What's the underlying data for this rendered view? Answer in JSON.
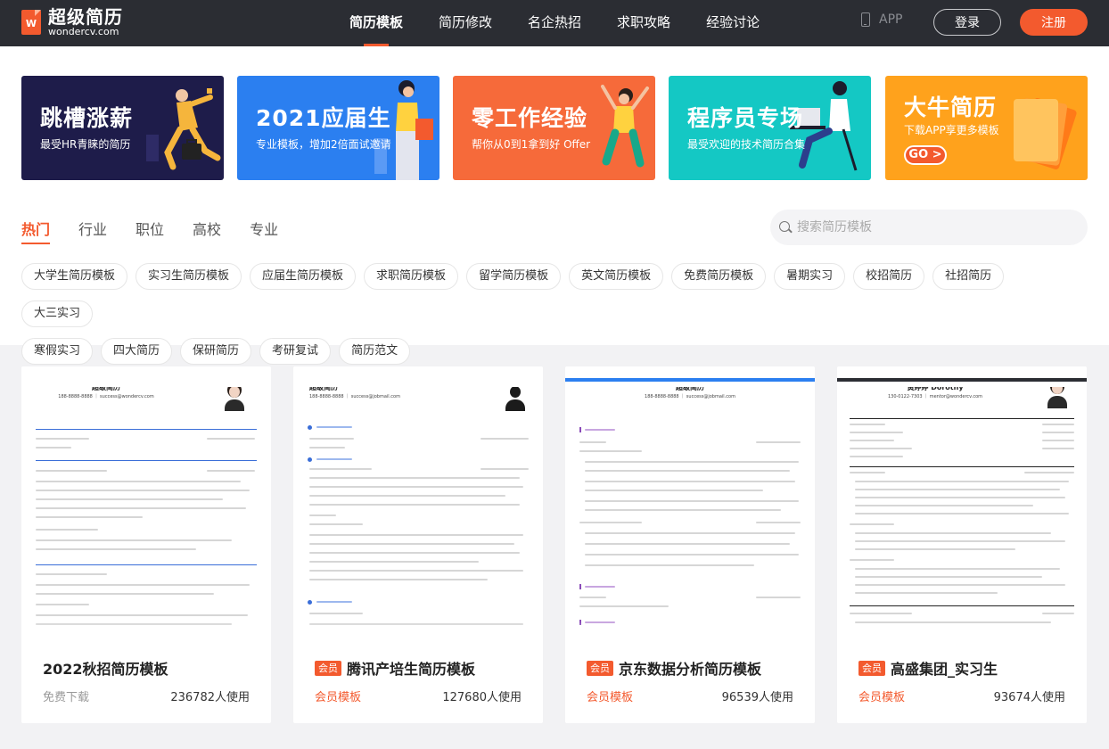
{
  "logo": {
    "mark": "W",
    "name": "超级简历",
    "domain": "wondercv.com"
  },
  "nav": {
    "items": [
      {
        "label": "简历模板",
        "active": true
      },
      {
        "label": "简历修改"
      },
      {
        "label": "名企热招"
      },
      {
        "label": "求职攻略"
      },
      {
        "label": "经验讨论"
      }
    ],
    "app_label": "APP",
    "login_label": "登录",
    "register_label": "注册"
  },
  "banners": [
    {
      "title": "跳槽涨薪",
      "subtitle": "最受HR青睐的简历",
      "bg": "#1e1c4a"
    },
    {
      "title": "2021应届生",
      "subtitle": "专业模板，增加2倍面试邀请",
      "bg": "#2b7ff0"
    },
    {
      "title": "零工作经验",
      "subtitle": "帮你从0到1拿到好 Offer",
      "bg": "#f66a3a"
    },
    {
      "title": "程序员专场",
      "subtitle": "最受欢迎的技术简历合集",
      "bg": "#14c8c4"
    },
    {
      "title": "大牛简历",
      "subtitle": "下载APP享更多模板",
      "button": "GO >",
      "bg": "#ffa21c"
    }
  ],
  "category_tabs": [
    {
      "label": "热门",
      "active": true
    },
    {
      "label": "行业"
    },
    {
      "label": "职位"
    },
    {
      "label": "高校"
    },
    {
      "label": "专业"
    }
  ],
  "search": {
    "placeholder": "搜索简历模板"
  },
  "tags": [
    "大学生简历模板",
    "实习生简历模板",
    "应届生简历模板",
    "求职简历模板",
    "留学简历模板",
    "英文简历模板",
    "免费简历模板",
    "暑期实习",
    "校招简历",
    "社招简历",
    "大三实习",
    "寒假实习",
    "四大简历",
    "保研简历",
    "考研复试",
    "简历范文"
  ],
  "templates": [
    {
      "title": "2022秋招简历模板",
      "vip": false,
      "price": "免费下载",
      "users": "236782人使用",
      "preview": {
        "name": "超级简历",
        "contact": "188-8888-8888 ｜ success@wondercv.com"
      }
    },
    {
      "title": "腾讯产培生简历模板",
      "vip": true,
      "badge": "会员",
      "price": "会员模板",
      "users": "127680人使用",
      "preview": {
        "name": "超级简历",
        "contact": "188-8888-8888 ｜ success@jobmail.com"
      }
    },
    {
      "title": "京东数据分析简历模板",
      "vip": true,
      "badge": "会员",
      "price": "会员模板",
      "users": "96539人使用",
      "preview": {
        "name": "超级简历",
        "contact": "188-8888-8888 ｜ success@jobmail.com"
      }
    },
    {
      "title": "高盛集团_实习生",
      "vip": true,
      "badge": "会员",
      "price": "会员模板",
      "users": "93674人使用",
      "preview": {
        "name": "黄婷婷 Dorothy",
        "contact": "130-0122-7303 ｜ mentor@wondercv.com"
      }
    }
  ],
  "colors": {
    "accent": "#f35a2e",
    "nav_bg": "#2b2d33",
    "page_bg": "#f2f2f4"
  }
}
